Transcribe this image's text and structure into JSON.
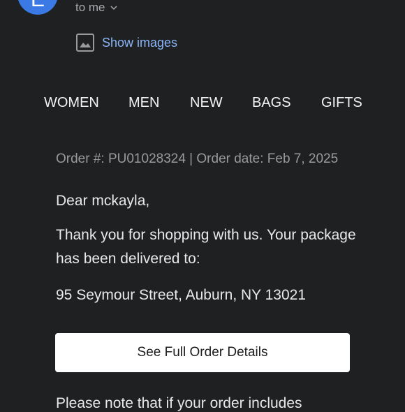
{
  "sender": {
    "avatar_letter": "E",
    "recipient_text": "to me"
  },
  "show_images_label": "Show images",
  "nav": [
    "WOMEN",
    "MEN",
    "NEW",
    "BAGS",
    "GIFTS"
  ],
  "order_meta": "Order #: PU01028324 | Order date: Feb 7, 2025",
  "greeting": "Dear mckayla,",
  "message": "Thank you for shopping with us. Your package has been delivered to:",
  "address": "95 Seymour Street, Auburn, NY 13021",
  "cta_label": "See Full Order Details",
  "note_partial": "Please note that if your order includes",
  "colors": {
    "background": "#1f2022",
    "link": "#8ab4f8",
    "avatar": "#3b7ae5",
    "button": "#ffffff"
  }
}
